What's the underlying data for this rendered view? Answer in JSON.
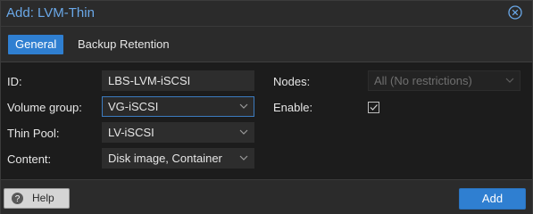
{
  "window": {
    "title": "Add: LVM-Thin"
  },
  "tabs": [
    {
      "label": "General",
      "active": true
    },
    {
      "label": "Backup Retention",
      "active": false
    }
  ],
  "form": {
    "id": {
      "label": "ID:",
      "value": "LBS-LVM-iSCSI"
    },
    "volume_group": {
      "label": "Volume group:",
      "value": "VG-iSCSI"
    },
    "thin_pool": {
      "label": "Thin Pool:",
      "value": "LV-iSCSI"
    },
    "content": {
      "label": "Content:",
      "value": "Disk image, Container"
    },
    "nodes": {
      "label": "Nodes:",
      "value": "All (No restrictions)",
      "disabled": true
    },
    "enable": {
      "label": "Enable:",
      "checked": true
    }
  },
  "footer": {
    "help_label": "Help",
    "add_label": "Add"
  },
  "icons": {
    "close": "close-circle-icon",
    "dropdown": "chevron-down-icon",
    "check": "check-icon",
    "help": "question-circle-icon"
  },
  "colors": {
    "accent": "#2f7fd1",
    "title": "#6aa8e8",
    "background": "#1c1c1c"
  }
}
